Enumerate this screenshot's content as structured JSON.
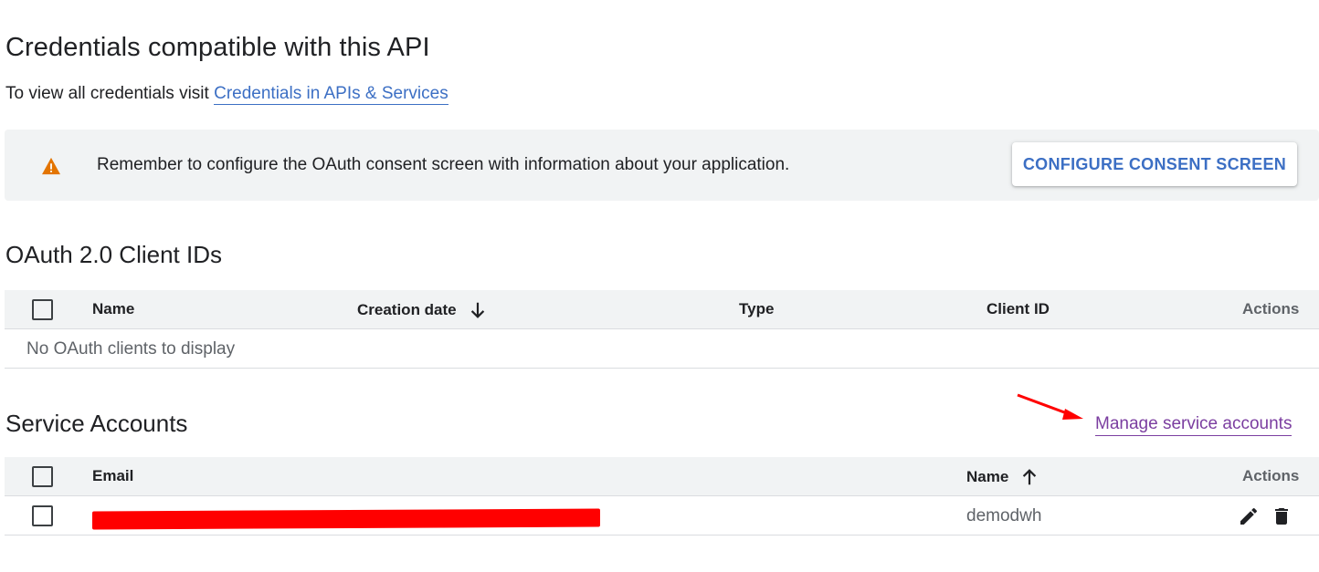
{
  "page": {
    "title": "Credentials compatible with this API",
    "intro_text": "To view all credentials visit",
    "intro_link": "Credentials in APIs & Services"
  },
  "banner": {
    "icon": "warning-icon",
    "message": "Remember to configure the OAuth consent screen with information about your application.",
    "button_label": "CONFIGURE CONSENT SCREEN",
    "colors": {
      "background": "#f1f3f4",
      "icon": "#e37400",
      "button_text": "#3c6fc4"
    }
  },
  "oauth": {
    "title": "OAuth 2.0 Client IDs",
    "columns": [
      "Name",
      "Creation date",
      "Type",
      "Client ID",
      "Actions"
    ],
    "sort_column": "Creation date",
    "sort_direction": "descending",
    "empty_message": "No OAuth clients to display"
  },
  "service_accounts": {
    "title": "Service Accounts",
    "manage_link": "Manage service accounts",
    "columns": [
      "Email",
      "Name",
      "Actions"
    ],
    "sort_column": "Name",
    "sort_direction": "ascending",
    "rows": [
      {
        "email_redacted": true,
        "name": "demodwh",
        "actions": [
          "edit-icon",
          "delete-icon"
        ]
      }
    ]
  },
  "annotation": {
    "arrow_color": "#ff0000",
    "redaction_color": "#ff0000"
  }
}
